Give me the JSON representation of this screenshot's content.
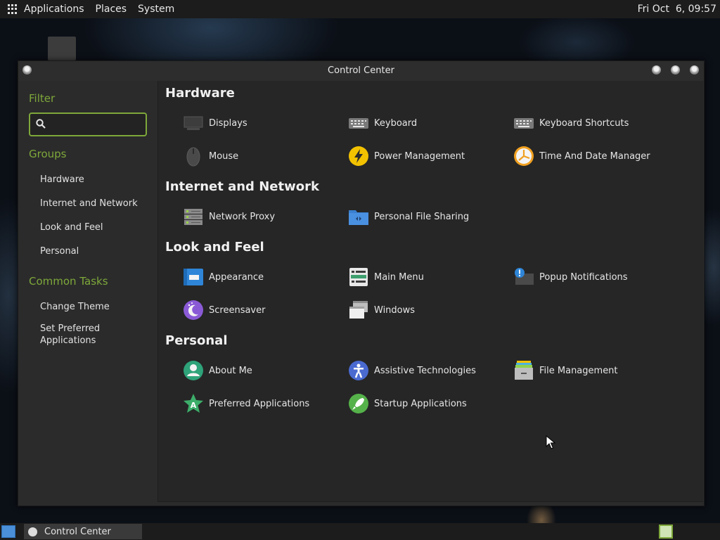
{
  "top_panel": {
    "menus": [
      "Applications",
      "Places",
      "System"
    ],
    "clock": "Fri Oct  6, 09:57"
  },
  "window": {
    "title": "Control Center"
  },
  "sidebar": {
    "filter_heading": "Filter",
    "search_placeholder": "",
    "groups_heading": "Groups",
    "groups": [
      "Hardware",
      "Internet and Network",
      "Look and Feel",
      "Personal"
    ],
    "tasks_heading": "Common Tasks",
    "tasks": [
      "Change Theme",
      "Set Preferred Applications"
    ]
  },
  "content": {
    "groups": [
      {
        "title": "Hardware",
        "items": [
          {
            "label": "Displays",
            "icon": "display-icon"
          },
          {
            "label": "Keyboard",
            "icon": "keyboard-icon"
          },
          {
            "label": "Keyboard Shortcuts",
            "icon": "keyboard-shortcuts-icon"
          },
          {
            "label": "Mouse",
            "icon": "mouse-icon"
          },
          {
            "label": "Power Management",
            "icon": "power-icon"
          },
          {
            "label": "Time And Date Manager",
            "icon": "clock-icon"
          }
        ]
      },
      {
        "title": "Internet and Network",
        "items": [
          {
            "label": "Network Proxy",
            "icon": "network-proxy-icon"
          },
          {
            "label": "Personal File Sharing",
            "icon": "folder-share-icon"
          }
        ]
      },
      {
        "title": "Look and Feel",
        "items": [
          {
            "label": "Appearance",
            "icon": "appearance-icon"
          },
          {
            "label": "Main Menu",
            "icon": "main-menu-icon"
          },
          {
            "label": "Popup Notifications",
            "icon": "notification-icon"
          },
          {
            "label": "Screensaver",
            "icon": "screensaver-icon"
          },
          {
            "label": "Windows",
            "icon": "windows-icon"
          }
        ]
      },
      {
        "title": "Personal",
        "items": [
          {
            "label": "About Me",
            "icon": "user-icon"
          },
          {
            "label": "Assistive Technologies",
            "icon": "accessibility-icon"
          },
          {
            "label": "File Management",
            "icon": "file-cabinet-icon"
          },
          {
            "label": "Preferred Applications",
            "icon": "preferred-apps-icon"
          },
          {
            "label": "Startup Applications",
            "icon": "rocket-icon"
          }
        ]
      }
    ]
  },
  "taskbar": {
    "task_label": "Control Center"
  },
  "colors": {
    "accent": "#7ea83a",
    "panel": "#1c1c1c",
    "window_bg": "#2b2b2b",
    "content_bg": "#262626"
  }
}
